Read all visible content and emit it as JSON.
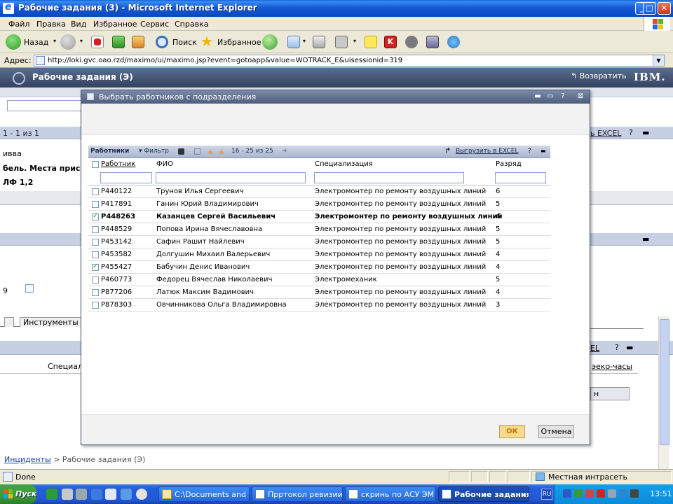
{
  "window": {
    "title": "Рабочие задания (3) - Microsoft Internet Explorer",
    "min_label": "_",
    "max_label": "□",
    "close_label": "✕"
  },
  "menu": [
    "Файл",
    "Правка",
    "Вид",
    "Избранное",
    "Сервис",
    "Справка"
  ],
  "toolbar": {
    "back_label": "Назад",
    "search_label": "Поиск",
    "favorites_label": "Избранное",
    "dropdown_glyph": "▾"
  },
  "address": {
    "label": "Адрес:",
    "url": "http://loki.gvc.oao.rzd/maximo/ui/maximo.jsp?event=gotoapp&value=WOTRACK_E&uisessionid=319",
    "drop_glyph": "▼"
  },
  "app": {
    "title": "Рабочие задания (Э)",
    "return_label": "Возвратить",
    "brand": "IBM.",
    "paging": "1 - 1 из 1",
    "excel_label": "ь EXCEL",
    "help_glyph": "?",
    "min_glyph": "▬",
    "snippet_1": "ивва",
    "snippet_2": "бель. Места присоед",
    "snippet_3": "ЛФ 1,2",
    "snippet_4": "9",
    "tab_1": "Инструменты",
    "snippet_5": "Специали",
    "excel_label_2": "ЕL",
    "hours_label": "эеко-часы",
    "right_btn": "н",
    "breadcrumb_link": "Инциденты",
    "breadcrumb_rest": " > Рабочие задания (Э)"
  },
  "dialog": {
    "title": "Выбрать работников с подразделения",
    "btn_min": "▬",
    "btn_max": "▭",
    "btn_help": "?",
    "btn_close": "⊠",
    "table_title": "Работники",
    "filter_label": "Фильтр",
    "page_range": "16 - 25 из 25",
    "export_label": "Выгрузить в EXCEL",
    "help": "?",
    "columns": {
      "worker": "Работник",
      "fio": "ФИО",
      "spec": "Специализация",
      "grade": "Разряд"
    },
    "rows": [
      {
        "id": "P440122",
        "fio": "Трунов Илья Сергеевич",
        "spec": "Электромонтер по ремонту воздушных линий",
        "grade": "6",
        "checked": false
      },
      {
        "id": "P417891",
        "fio": "Ганин Юрий Владимирович",
        "spec": "Электромонтер по ремонту воздушных линий",
        "grade": "5",
        "checked": false
      },
      {
        "id": "P448263",
        "fio": "Казанцев Сергей Васильевич",
        "spec": "Электромонтер по ремонту воздушных линий",
        "grade": "4",
        "checked": true
      },
      {
        "id": "P448529",
        "fio": "Попова Ирина Вячеславовна",
        "spec": "Электромонтер по ремонту воздушных линий",
        "grade": "5",
        "checked": false
      },
      {
        "id": "P453142",
        "fio": "Сафин Рашит Найлевич",
        "spec": "Электромонтер по ремонту воздушных линий",
        "grade": "5",
        "checked": false
      },
      {
        "id": "P453582",
        "fio": "Долгушин Михаил Валерьевич",
        "spec": "Электромонтер по ремонту воздушных линий",
        "grade": "4",
        "checked": false
      },
      {
        "id": "P455427",
        "fio": "Бабучин Денис Иванович",
        "spec": "Электромонтер по ремонту воздушных линий",
        "grade": "4",
        "checked": true
      },
      {
        "id": "P460773",
        "fio": "Федорец Вячеслав Николаевич",
        "spec": "Электромеханик",
        "grade": "5",
        "checked": false
      },
      {
        "id": "P877206",
        "fio": "Латюк Максим Вадимович",
        "spec": "Электромонтер по ремонту воздушных линий",
        "grade": "4",
        "checked": false
      },
      {
        "id": "P878303",
        "fio": "Овчинникова Ольга Владимировна",
        "spec": "Электромонтер по ремонту воздушных линий",
        "grade": "3",
        "checked": false
      }
    ],
    "ok_label": "ОК",
    "cancel_label": "Отмена"
  },
  "status": {
    "done": "Done",
    "zone": "Местная интрасеть"
  },
  "taskbar": {
    "start_label": "Пуск",
    "tasks": [
      "C:\\Documents and S...",
      "Прртокол ревизии ...",
      "скринь по АСУ ЭМ ...",
      "Рабочие задания..."
    ],
    "lang": "RU",
    "clock": "13:51"
  }
}
